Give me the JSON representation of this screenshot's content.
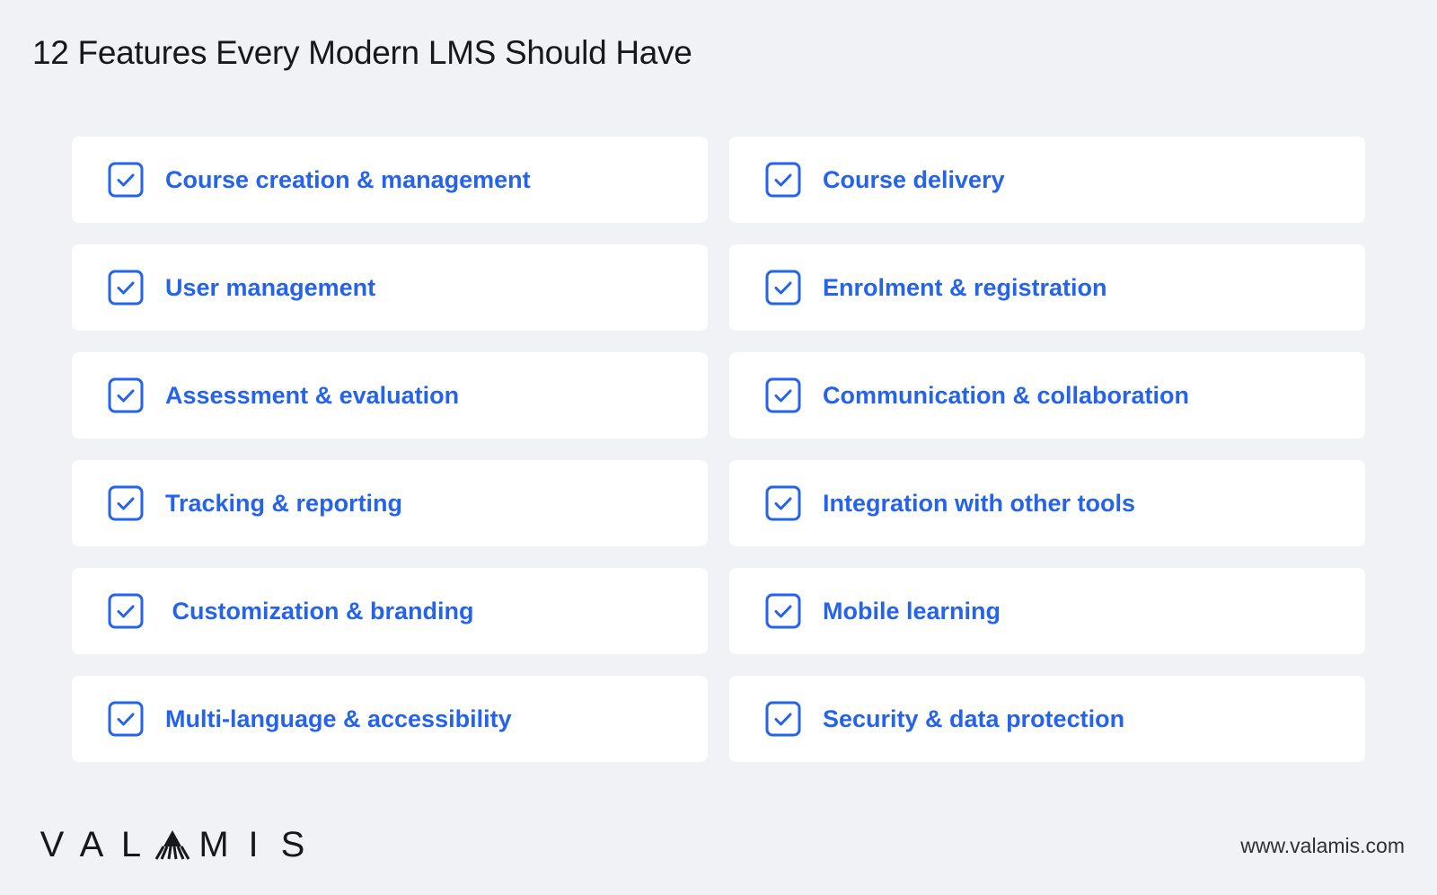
{
  "title": "12 Features Every Modern LMS Should Have",
  "colors": {
    "background": "#f1f2f6",
    "card": "#ffffff",
    "accent": "#2563eb",
    "title": "#17181b"
  },
  "features": [
    {
      "label": "Course creation & management",
      "icon": "checkbox-checked-icon",
      "checked": true
    },
    {
      "label": "Course delivery",
      "icon": "checkbox-checked-icon",
      "checked": true
    },
    {
      "label": "User management",
      "icon": "checkbox-checked-icon",
      "checked": true
    },
    {
      "label": "Enrolment & registration",
      "icon": "checkbox-checked-icon",
      "checked": true
    },
    {
      "label": "Assessment & evaluation",
      "icon": "checkbox-checked-icon",
      "checked": true
    },
    {
      "label": "Communication & collaboration",
      "icon": "checkbox-checked-icon",
      "checked": true
    },
    {
      "label": "Tracking & reporting",
      "icon": "checkbox-checked-icon",
      "checked": true
    },
    {
      "label": "Integration with other tools",
      "icon": "checkbox-checked-icon",
      "checked": true
    },
    {
      "label": " Customization & branding",
      "icon": "checkbox-checked-icon",
      "checked": true
    },
    {
      "label": "Mobile learning",
      "icon": "checkbox-checked-icon",
      "checked": true
    },
    {
      "label": "Multi-language & accessibility",
      "icon": "checkbox-checked-icon",
      "checked": true
    },
    {
      "label": "Security & data protection",
      "icon": "checkbox-checked-icon",
      "checked": true
    }
  ],
  "footer": {
    "logo_letters_before": [
      "V",
      "A",
      "L"
    ],
    "logo_letters_after": [
      "M",
      "I",
      "S"
    ],
    "logo_text": "VALAMIS",
    "website": "www.valamis.com"
  }
}
